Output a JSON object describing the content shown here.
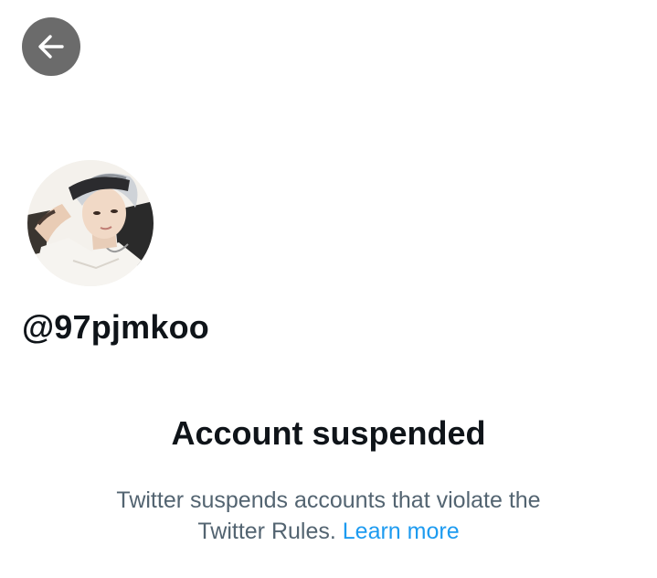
{
  "header": {
    "back_icon": "arrow-left-icon"
  },
  "profile": {
    "handle": "@97pjmkoo",
    "avatar_icon": "profile-avatar"
  },
  "empty_state": {
    "title": "Account suspended",
    "description_part1": "Twitter suspends accounts that violate the Twitter Rules.",
    "link_label": "Learn more"
  },
  "colors": {
    "back_button_bg": "#6b6b6b",
    "text_primary": "#0f1419",
    "text_secondary": "#536471",
    "link": "#1d9bf0"
  }
}
